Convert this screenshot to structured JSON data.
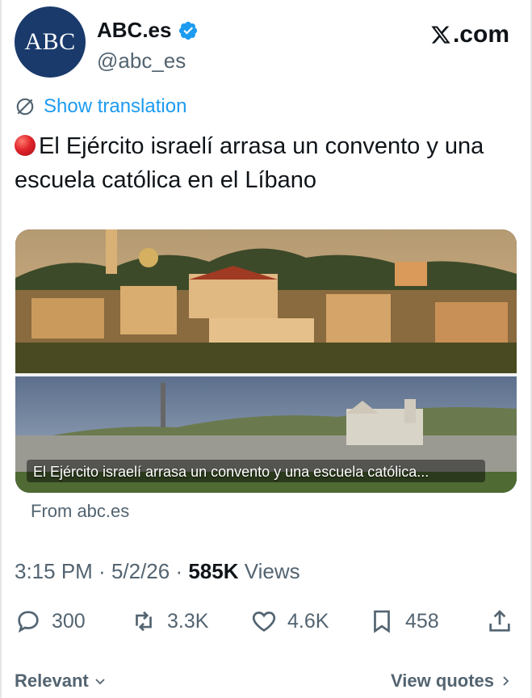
{
  "account": {
    "avatar_text": "ABC",
    "display_name": "ABC.es",
    "handle": "@abc_es",
    "verified_icon": "verified-badge-icon",
    "accent_color": "#1d9bf0"
  },
  "site_label": ".com",
  "translation": {
    "label": "Show translation",
    "icon": "globe-translate-icon"
  },
  "tweet": {
    "text": "El Ejército israelí arrasa un convento y una escuela católica en el Líbano"
  },
  "card": {
    "caption": "El Ejército israelí arrasa un convento y una escuela católica...",
    "source": "From abc.es"
  },
  "meta": {
    "time": "3:15 PM",
    "sep1": " · ",
    "date": "5/2/26",
    "sep2": " · ",
    "views_count": "585K",
    "views_label": " Views"
  },
  "actions": {
    "replies": "300",
    "reposts": "3.3K",
    "likes": "4.6K",
    "bookmarks": "458"
  },
  "footer": {
    "sort_label": "Relevant",
    "quotes_label": "View quotes"
  }
}
